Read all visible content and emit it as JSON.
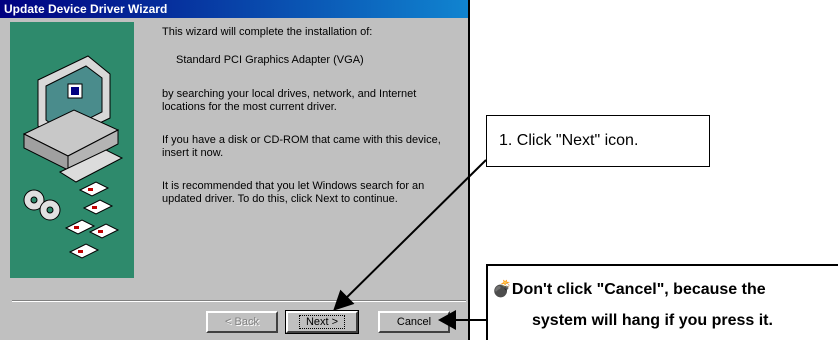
{
  "window": {
    "title": "Update Device Driver Wizard"
  },
  "content": {
    "line1": "This wizard will complete the installation of:",
    "device": "Standard PCI Graphics Adapter (VGA)",
    "line3": "by searching your local drives, network, and Internet locations for the most current driver.",
    "line4": "If you have a disk or CD-ROM that came with this device, insert it now.",
    "line5": "It is recommended that you let Windows search for an updated driver. To do this, click Next to continue."
  },
  "buttons": {
    "back": "< Back",
    "next": "Next >",
    "cancel": "Cancel"
  },
  "annotations": {
    "callout1": "1. Click \"Next\" icon.",
    "callout2_icon": "bomb-icon",
    "callout2_line1": "Don't click \"Cancel\", because the",
    "callout2_line2": "system will hang if you press it."
  },
  "colors": {
    "titlebar": "#000080",
    "illustration_bg": "#2e8a6c",
    "dialog_bg": "#c0c0c0"
  }
}
